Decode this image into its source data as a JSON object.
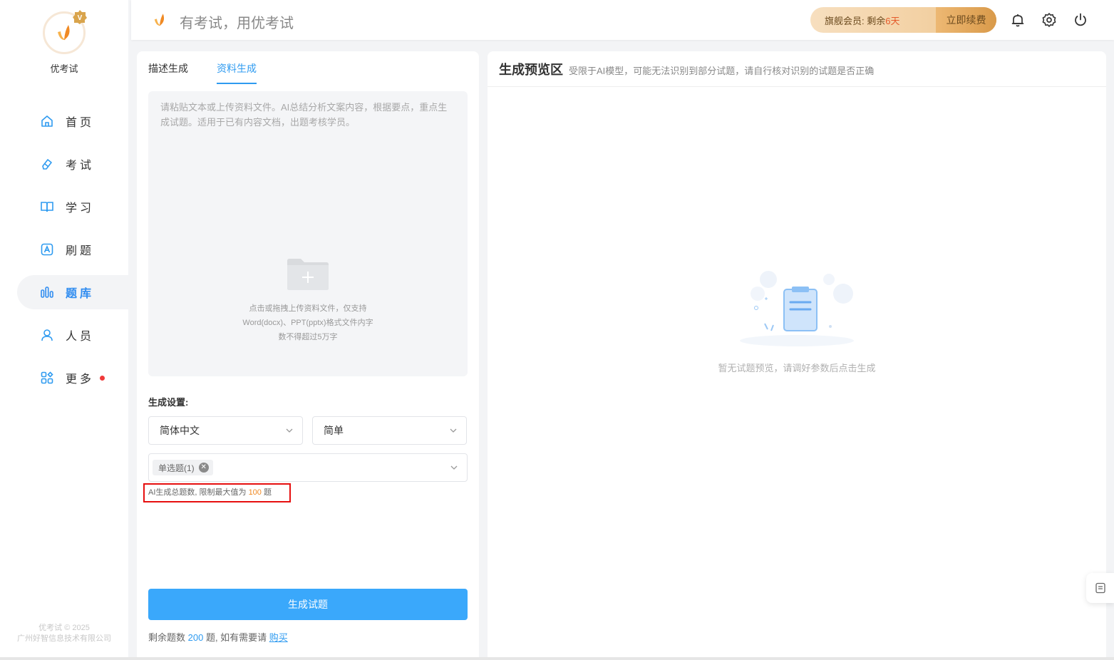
{
  "app": {
    "name": "优考试",
    "slogan": "有考试，用优考试",
    "copyright_line1": "优考试 © 2025",
    "copyright_line2": "广州好智信息技术有限公司"
  },
  "sidebar": {
    "items": [
      {
        "label": "首页",
        "icon": "home-icon"
      },
      {
        "label": "考试",
        "icon": "eraser-icon"
      },
      {
        "label": "学习",
        "icon": "book-icon"
      },
      {
        "label": "刷题",
        "icon": "letter-a-icon"
      },
      {
        "label": "题库",
        "icon": "bar-chart-icon",
        "active": true
      },
      {
        "label": "人员",
        "icon": "user-icon"
      },
      {
        "label": "更多",
        "icon": "apps-icon",
        "badge": "red-dot"
      }
    ]
  },
  "header": {
    "vip_prefix": "旗舰会员:  剩余",
    "vip_days": "6天",
    "renew_label": "立即续费",
    "icons": [
      "bell-icon",
      "gear-icon",
      "power-icon"
    ]
  },
  "left": {
    "tabs": [
      "描述生成",
      "资料生成"
    ],
    "active_tab": "资料生成",
    "placeholder": "请粘贴文本或上传资料文件。AI总结分析文案内容，根据要点，重点生成试题。适用于已有内容文档，出题考核学员。",
    "upload_hint_1": "点击或拖拽上传资料文件，仅支持",
    "upload_hint_2": "Word(docx)、PPT(pptx)格式文件内字",
    "upload_hint_3": "数不得超过5万字",
    "settings_title": "生成设置:",
    "language": "简体中文",
    "difficulty": "简单",
    "question_type_tag": "单选题(1)",
    "limit_prefix": "AI生成总题数, 限制最大值为 ",
    "limit_value": "100",
    "limit_suffix": " 题",
    "generate_label": "生成试题",
    "remain_prefix": "剩余题数 ",
    "remain_value": "200",
    "remain_suffix": " 题, 如有需要请 ",
    "buy_label": "购买"
  },
  "right": {
    "title": "生成预览区",
    "note": "受限于AI模型，可能无法识别到部分试题，请自行核对识别的试题是否正确",
    "empty_text": "暂无试题预览，请调好参数后点击生成"
  },
  "colors": {
    "accent": "#2f9bf0",
    "button": "#3aa8fb",
    "vip_gold": "#e4a75e",
    "warn": "#f08a24",
    "highlight_box": "#e60f0f"
  }
}
